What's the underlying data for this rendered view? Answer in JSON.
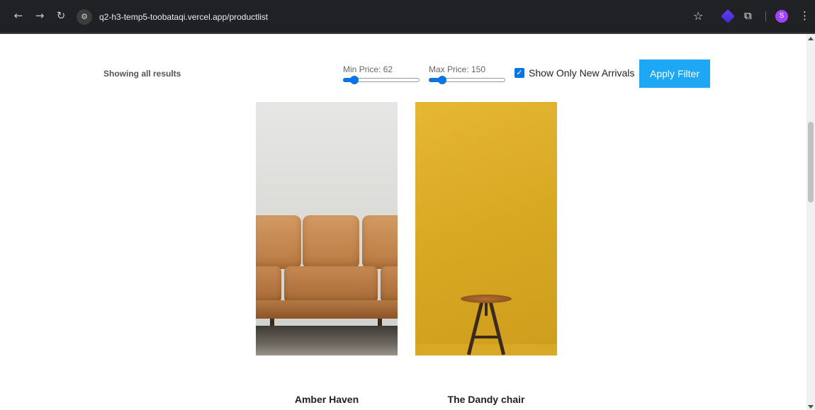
{
  "browser": {
    "url": "q2-h3-temp5-toobataqi.vercel.app/productlist",
    "avatar_letter": "S",
    "icons": {
      "back": "back-arrow-icon",
      "forward": "forward-arrow-icon",
      "reload": "reload-icon",
      "site_info": "site-settings-icon",
      "bookmark": "star-icon",
      "extension": "extension-icon",
      "extensions_menu": "puzzle-icon",
      "menu": "kebab-menu-icon"
    }
  },
  "filters": {
    "results_label": "Showing all results",
    "min_price": {
      "label": "Min Price: 62",
      "level": 0.15
    },
    "max_price": {
      "label": "Max Price: 150",
      "level": 0.18
    },
    "new_arrivals": {
      "label": "Show Only New Arrivals",
      "checked": true
    },
    "apply_label": "Apply Filter"
  },
  "products": [
    {
      "name": "Amber Haven",
      "image": "leather-sofa"
    },
    {
      "name": "The Dandy chair",
      "image": "wooden-stool"
    }
  ],
  "colors": {
    "accent": "#0b74e5",
    "button": "#1ea7f5",
    "chrome": "#202124"
  }
}
